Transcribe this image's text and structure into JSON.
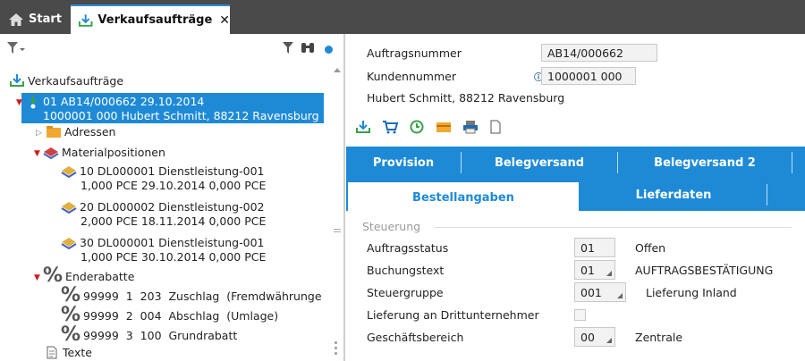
{
  "tabs": {
    "start": "Start",
    "active": "Verkaufsaufträge"
  },
  "tree": {
    "root": "Verkaufsaufträge",
    "selected_line1": "01 AB14/000662 29.10.2014",
    "selected_line2": "1000001 000 Hubert Schmitt, 88212 Ravensburg",
    "adressen": "Adressen",
    "materialpositionen": "Materialpositionen",
    "positions": [
      {
        "line1": "10 DL000001 Dienstleistung-001",
        "line2": "1,000 PCE 29.10.2014 0,000 PCE"
      },
      {
        "line1": "20 DL000002 Dienstleistung-002",
        "line2": "2,000 PCE 18.11.2014 0,000 PCE"
      },
      {
        "line1": "30 DL000001 Dienstleistung-001",
        "line2": "1,000 PCE 30.10.2014 0,000 PCE"
      }
    ],
    "enderabatte": "Enderabatte",
    "rabatte": [
      "99999  1  203  Zuschlag  (Fremdwährunge",
      "99999  2  004  Abschlag  (Umlage)",
      "99999  3  100  Grundrabatt"
    ],
    "texte": "Texte"
  },
  "header": {
    "auftragsnummer_label": "Auftragsnummer",
    "auftragsnummer_value": "AB14/000662",
    "kundennummer_label": "Kundennummer",
    "kundennummer_value": "1000001 000",
    "kunde": "Hubert Schmitt, 88212 Ravensburg"
  },
  "tabs_row1": [
    "Provision",
    "Belegversand",
    "Belegversand 2"
  ],
  "tabs_row2": [
    "Bestellangaben",
    "Lieferdaten"
  ],
  "steuerung": {
    "title": "Steuerung",
    "auftragsstatus_label": "Auftragsstatus",
    "auftragsstatus_value": "01",
    "auftragsstatus_text": "Offen",
    "buchungstext_label": "Buchungstext",
    "buchungstext_value": "01",
    "buchungstext_text": "AUFTRAGSBESTÄTIGUNG",
    "steuergruppe_label": "Steuergruppe",
    "steuergruppe_value": "001",
    "steuergruppe_text": "Lieferung Inland",
    "drittunternehmer_label": "Lieferung an Drittunternehmer",
    "geschaeftsbereich_label": "Geschäftsbereich",
    "geschaeftsbereich_value": "00",
    "geschaeftsbereich_text": "Zentrale"
  },
  "colors": {
    "accent": "#1e8ad6",
    "topbar": "#4a4a4a",
    "tree_red": "#d41a1a"
  }
}
